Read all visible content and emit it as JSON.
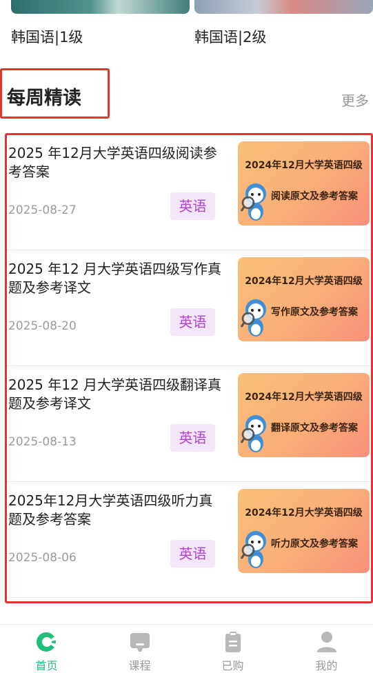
{
  "courses": [
    {
      "title": "韩国语|1级"
    },
    {
      "title": "韩国语|2级"
    }
  ],
  "section": {
    "title": "每周精读",
    "more_label": "更多"
  },
  "articles": [
    {
      "title": "2025 年12月大学英语四级阅读参考答案",
      "date": "2025-08-27",
      "tag": "英语",
      "cover_title": "2024年12月大学英语四级",
      "cover_subtitle": "阅读原文及参考答案"
    },
    {
      "title": "2025 年12 月大学英语四级写作真题及参考译文",
      "date": "2025-08-20",
      "tag": "英语",
      "cover_title": "2024年12月大学英语四级",
      "cover_subtitle": "写作原文及参考答案"
    },
    {
      "title": "2025 年12 月大学英语四级翻译真题及参考译文",
      "date": "2025-08-13",
      "tag": "英语",
      "cover_title": "2024年12月大学英语四级",
      "cover_subtitle": "翻译原文及参考答案"
    },
    {
      "title": "2025年12月大学英语四级听力真题及参考答案",
      "date": "2025-08-06",
      "tag": "英语",
      "cover_title": "2024年12月大学英语四级",
      "cover_subtitle": "听力原文及参考答案"
    }
  ],
  "nav": [
    {
      "label": "首页",
      "icon": "home-icon",
      "active": true
    },
    {
      "label": "课程",
      "icon": "course-icon",
      "active": false
    },
    {
      "label": "已购",
      "icon": "clipboard-icon",
      "active": false
    },
    {
      "label": "我的",
      "icon": "user-icon",
      "active": false
    }
  ],
  "colors": {
    "accent": "#1fbf7b",
    "highlight_border": "#e8322f",
    "tag_text": "#b040d0",
    "tag_bg": "#f4e6fb"
  }
}
